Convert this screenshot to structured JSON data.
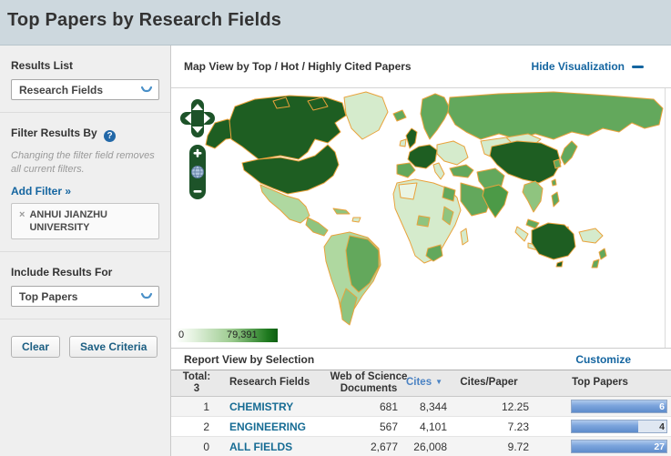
{
  "title": "Top Papers by Research Fields",
  "sidebar": {
    "results_list": {
      "label": "Results List",
      "selected": "Research Fields"
    },
    "filter": {
      "label": "Filter Results By",
      "note": "Changing the filter field removes all current filters.",
      "add_filter_label": "Add Filter »",
      "active_filters": [
        {
          "label": "ANHUI JIANZHU UNIVERSITY",
          "remove_symbol": "×"
        }
      ]
    },
    "include": {
      "label": "Include Results For",
      "selected": "Top Papers"
    },
    "buttons": {
      "clear": "Clear",
      "save": "Save Criteria"
    }
  },
  "map": {
    "title": "Map View by Top / Hot / Highly Cited Papers",
    "hide_link": "Hide Visualization",
    "legend": {
      "min": "0",
      "max": "79,391"
    },
    "controls": {
      "zoom_in": "+",
      "zoom_out": "−",
      "pan": "pan-compass",
      "globe": "globe-icon"
    }
  },
  "report": {
    "title": "Report View by Selection",
    "customize_link": "Customize",
    "table": {
      "total_label": "Total:",
      "total_value": "3",
      "columns": [
        "Research Fields",
        "Web of Science Documents",
        "Cites",
        "Cites/Paper",
        "Top Papers"
      ],
      "sorted_column": "Cites",
      "rows": [
        {
          "rank": "1",
          "field": "CHEMISTRY",
          "documents": "681",
          "cites": "8,344",
          "cites_per_paper": "12.25",
          "top_papers": "6",
          "top_papers_pct": 100
        },
        {
          "rank": "2",
          "field": "ENGINEERING",
          "documents": "567",
          "cites": "4,101",
          "cites_per_paper": "7.23",
          "top_papers": "4",
          "top_papers_pct": 70
        },
        {
          "rank": "0",
          "field": "ALL FIELDS",
          "documents": "2,677",
          "cites": "26,008",
          "cites_per_paper": "9.72",
          "top_papers": "27",
          "top_papers_pct": 100
        }
      ]
    }
  },
  "chart_data": {
    "type": "heatmap",
    "title": "Map View by Top / Hot / Highly Cited Papers (world choropleth)",
    "legend_range": [
      0,
      79391
    ],
    "notes": "Green intensity = papers per country; darkest: USA, Canada, China, Australia, UK, France, Germany; medium: Russia, Brazil, India, Spain, Scandinavia, Turkey, Iran, Saudi Arabia, Japan; pale: Africa, Eastern Europe, Greenland"
  },
  "colors": {
    "titlebar_bg": "#cdd8de",
    "link_blue": "#1465a0",
    "field_link_blue": "#176c94",
    "cites_sort_blue": "#4a82c3",
    "map_dark_green": "#1e5e22",
    "map_medium_green": "#63a85c",
    "map_light_green": "#afd8a0",
    "map_pale_green": "#d5ebcc",
    "map_border_orange": "#e9a23b",
    "control_green": "#1d5329",
    "bar_blue": "#6d9cd6"
  }
}
